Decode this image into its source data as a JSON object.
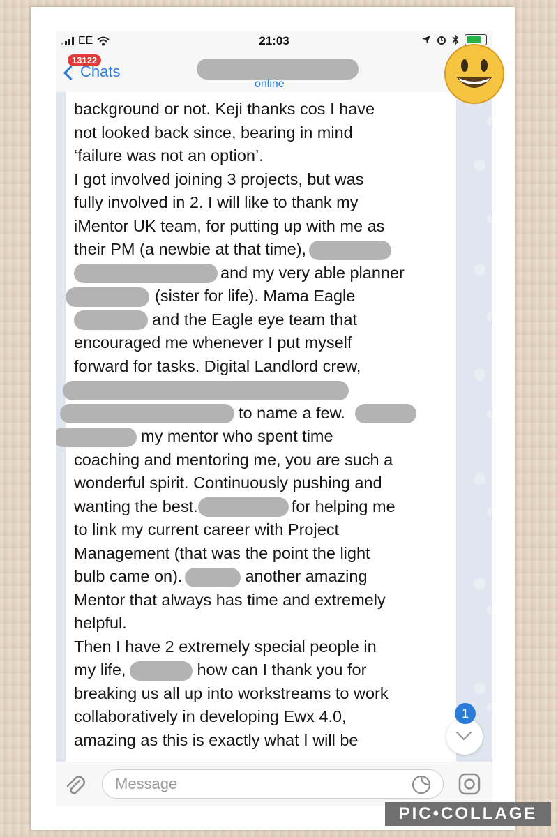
{
  "statusbar": {
    "carrier": "EE",
    "time": "21:03",
    "wifi_icon": "wifi-icon",
    "location_icon": "location-arrow-icon",
    "alarm_icon": "alarm-icon",
    "bluetooth_icon": "bluetooth-icon",
    "battery_color": "#2ab24a"
  },
  "navbar": {
    "back_label": "Chats",
    "unread_badge": "13122",
    "subtitle": "online",
    "accent": "#2b7bd8"
  },
  "message": {
    "lines": [
      "background or not. Keji thanks cos I have",
      "not looked back since, bearing in mind",
      "‘failure was not an option’.",
      "I got involved joining 3 projects, but was",
      "fully involved in 2. I will like to thank my",
      "iMentor UK team, for putting up with me as",
      "their PM (a newbie at that time),",
      "and my very able planner",
      "(sister for life). Mama Eagle",
      "and the Eagle eye team that",
      "encouraged me whenever I put myself",
      "forward for tasks. Digital Landlord crew,",
      "to name a few.",
      "my mentor who spent time",
      "coaching and mentoring me, you are such a",
      "wonderful spirit. Continuously pushing and",
      "wanting the best.",
      "for helping me",
      "to link my current career with Project",
      "Management (that was the point the light",
      "bulb came on).",
      "another amazing",
      "Mentor that always has time and extremely",
      "helpful.",
      "Then I have 2 extremely special people in",
      "my life,",
      "how can I thank you for",
      "breaking us all up into workstreams to work",
      "collaboratively in developing Ewx 4.0,",
      "amazing as this is exactly what I will be"
    ]
  },
  "scroll_button": {
    "unread_count": "1",
    "icon": "chevron-down-icon"
  },
  "input": {
    "placeholder": "Message",
    "attach_icon": "paperclip-icon",
    "sticker_icon": "sticker-icon",
    "camera_icon": "camera-icon"
  },
  "overlay": {
    "emoji": "smiley-emoji-icon",
    "watermark": "PIC•COLLAGE"
  }
}
